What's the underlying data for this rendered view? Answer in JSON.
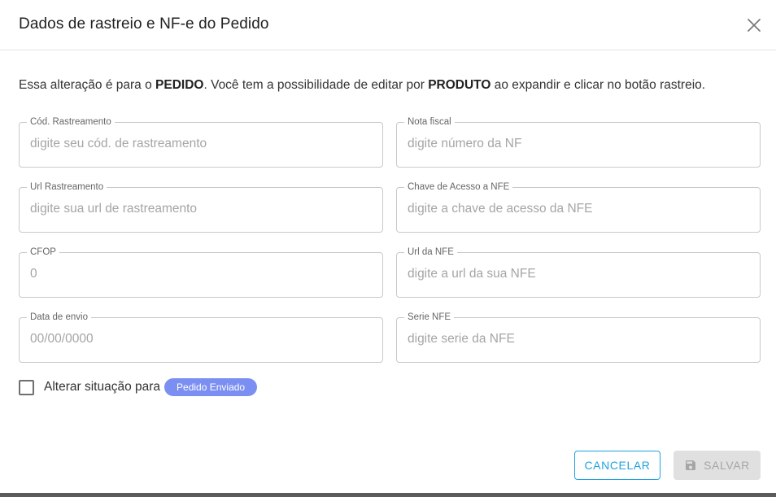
{
  "dialog": {
    "title": "Dados de rastreio e NF-e do Pedido",
    "close_icon": "close-icon"
  },
  "info": {
    "part1": "Essa alteração é para o ",
    "pedido": "PEDIDO",
    "part2": ". Você tem a possibilidade de editar por ",
    "produto": "PRODUTO",
    "part3": " ao expandir e clicar no botão rastreio."
  },
  "fields": {
    "cod_rastreamento": {
      "label": "Cód. Rastreamento",
      "placeholder": "digite seu cód. de rastreamento"
    },
    "nota_fiscal": {
      "label": "Nota fiscal",
      "placeholder": "digite número da NF"
    },
    "url_rastreamento": {
      "label": "Url Rastreamento",
      "placeholder": "digite sua url de rastreamento"
    },
    "chave_acesso": {
      "label": "Chave de Acesso a NFE",
      "placeholder": "digite a chave de acesso da NFE"
    },
    "cfop": {
      "label": "CFOP",
      "placeholder": "0"
    },
    "url_nfe": {
      "label": "Url da NFE",
      "placeholder": "digite a url da sua NFE"
    },
    "data_envio": {
      "label": "Data de envio",
      "placeholder": "00/00/0000"
    },
    "serie_nfe": {
      "label": "Serie NFE",
      "placeholder": "digite serie da NFE"
    }
  },
  "status_change": {
    "checked": false,
    "label": "Alterar situação para",
    "chip": "Pedido Enviado",
    "chip_color": "#7b8ff2"
  },
  "actions": {
    "cancel": "CANCELAR",
    "save": "SALVAR",
    "save_icon": "floppy-disk-icon",
    "cancel_color": "#1fa3e0"
  }
}
